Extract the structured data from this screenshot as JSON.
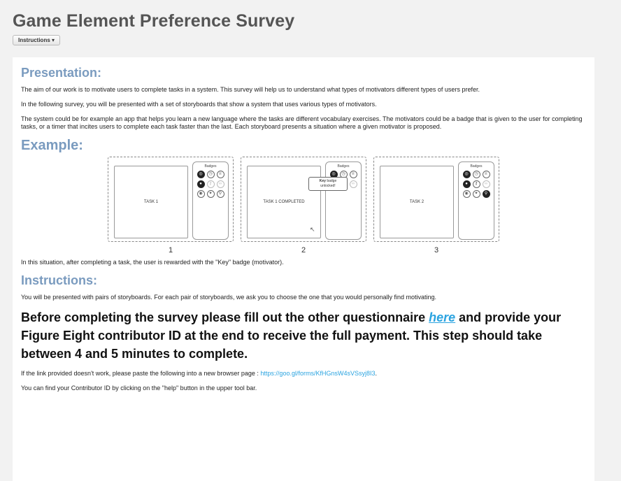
{
  "header": {
    "title": "Game Element Preference Survey",
    "instructions_button": "Instructions"
  },
  "presentation": {
    "heading": "Presentation:",
    "paragraphs": [
      "The aim of our work is to motivate users to complete tasks in a system. This survey will help us to understand what types of motivators different types of users prefer.",
      "In the following survey, you will be presented with a set of storyboards that show a system that uses various types of motivators.",
      "The system could be for example an app that helps you learn a new language where the tasks are different vocabulary exercises. The motivators could be a badge that is given to the user for completing tasks, or a timer that incites users to complete each task faster than the last. Each storyboard presents a situation where a given motivator is proposed."
    ]
  },
  "example": {
    "heading": "Example:",
    "frames": [
      {
        "task_label": "TASK 1",
        "badges_label": "Badges",
        "number": "1"
      },
      {
        "task_label": "TASK 1 COMPLETED",
        "badges_label": "Badges",
        "number": "2",
        "tooltip_bold": "Key",
        "tooltip_rest": " badge",
        "tooltip_line2": "unlocked!"
      },
      {
        "task_label": "TASK 2",
        "badges_label": "Badges",
        "number": "3"
      }
    ],
    "caption": "In this situation, after completing a task, the user is rewarded with the \"Key\" badge (motivator)."
  },
  "instructions": {
    "heading": "Instructions:",
    "intro": "You will be presented with pairs of storyboards. For each pair of storyboards, we ask you to choose the one that you would personally find motivating.",
    "big_before": "Before completing the survey please fill out the other questionnaire ",
    "big_link": "here",
    "big_after": " and provide your Figure Eight contributor ID at the end to receive the full payment. This step should take between 4 and 5 minutes to complete.",
    "link_note_before": "If the link provided doesn't work, please paste the following into a new browser page : ",
    "link_url": "https://goo.gl/forms/KfHGnsW4sVSsyj8I3",
    "link_note_after": ".",
    "contributor_note": "You can find your Contributor ID by clicking on the \"help\" button in the upper tool bar."
  },
  "colors": {
    "heading": "#7a9bbf",
    "link": "#2aa3e0"
  }
}
